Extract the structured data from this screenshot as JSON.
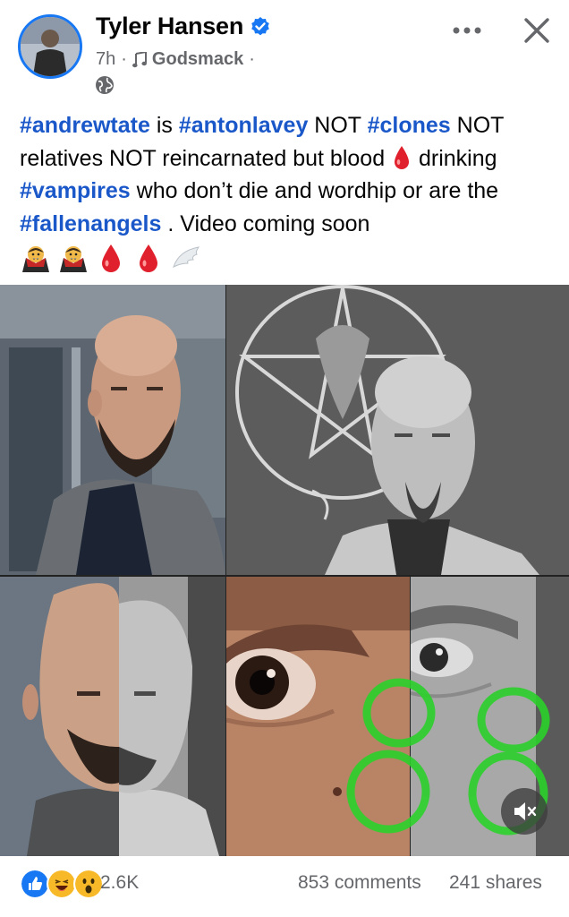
{
  "post": {
    "author": "Tyler Hansen",
    "time": "7h",
    "separator": "·",
    "song": "Godsmack",
    "text_parts": {
      "t1": "#andrewtate",
      "t2": " is ",
      "t3": "#antonlavey",
      "t4": "  NOT ",
      "t5": "#clones",
      "t6": " NOT relatives NOT reincarnated but blood ",
      "t7": " drinking ",
      "t8": "#vampires",
      "t9": " who don’t die and wordhip or are the ",
      "t10": "#fallenangels",
      "t11": " . Video coming soon"
    },
    "emoji_row": [
      "vampire-emoji",
      "vampire-emoji",
      "blood-drop-emoji",
      "blood-drop-emoji",
      "wing-emoji"
    ]
  },
  "footer": {
    "reaction_count": "2.6K",
    "comments": "853 comments",
    "shares": "241 shares"
  },
  "colors": {
    "accent": "#1877f2",
    "hashtag": "#1a57c9",
    "meta_text": "#65676b",
    "green_overlay": "#2bd12b"
  },
  "icons": [
    "verified-badge-icon",
    "music-note-icon",
    "globe-icon",
    "more-icon",
    "close-icon",
    "mute-icon",
    "like-icon",
    "haha-icon",
    "wow-icon"
  ]
}
